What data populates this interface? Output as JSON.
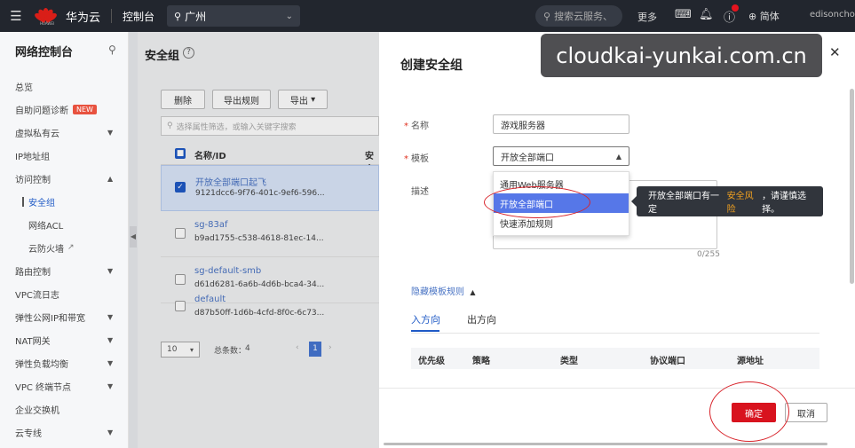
{
  "topbar": {
    "brand_name": "华为云",
    "brand_logo_text": "HUAWEI",
    "console": "控制台",
    "region": "广州",
    "search_placeholder": "搜索云服务、",
    "more": "更多",
    "language": "简体",
    "user": "edisonchoi"
  },
  "sidebar": {
    "title": "网络控制台",
    "items": [
      {
        "label": "总览"
      },
      {
        "label": "自助问题诊断",
        "badge": "NEW"
      },
      {
        "label": "虚拟私有云"
      },
      {
        "label": "IP地址组"
      },
      {
        "label": "访问控制"
      },
      {
        "label": "安全组"
      },
      {
        "label": "网络ACL"
      },
      {
        "label": "云防火墙"
      },
      {
        "label": "路由控制"
      },
      {
        "label": "VPC流日志"
      },
      {
        "label": "弹性公网IP和带宽"
      },
      {
        "label": "NAT网关"
      },
      {
        "label": "弹性负载均衡"
      },
      {
        "label": "VPC 终端节点"
      },
      {
        "label": "企业交换机"
      },
      {
        "label": "云专线"
      }
    ]
  },
  "main": {
    "title": "安全组",
    "buttons": {
      "delete": "删除",
      "export_rules": "导出规则",
      "export": "导出"
    },
    "filter_placeholder": "选择属性筛选，或输入关键字搜索",
    "columns": {
      "name_id": "名称/ID",
      "security": "安全"
    },
    "rows": [
      {
        "name": "开放全部端口起飞",
        "id": "9121dcc6-9f76-401c-9ef6-596..."
      },
      {
        "name": "sg-83af",
        "id": "b9ad1755-c538-4618-81ec-14..."
      },
      {
        "name": "sg-default-smb",
        "id": "d61d6281-6a6b-4d6b-bca4-34..."
      },
      {
        "name": "default",
        "id": "d87b50ff-1d6b-4cfd-8f0c-6c73..."
      }
    ],
    "pager": {
      "size": "10",
      "total_label": "总条数：",
      "total": "4",
      "current": "1"
    }
  },
  "panel": {
    "title": "创建安全组",
    "watermark": "cloudkai-yunkai.com.cn",
    "name_label": "名称",
    "name_value": "游戏服务器",
    "template_label": "模板",
    "template_value": "开放全部端口",
    "desc_label": "描述",
    "counter": "0/255",
    "options": [
      "通用Web服务器",
      "开放全部端口",
      "快速添加规则"
    ],
    "tooltip_before": "开放全部端口有一定",
    "tooltip_warn": "安全风险",
    "tooltip_after": "，请谨慎选择。",
    "hide_rules": "隐藏模板规则",
    "tabs": [
      "入方向",
      "出方向"
    ],
    "rule_columns": [
      "优先级",
      "策略",
      "类型",
      "协议端口",
      "源地址"
    ],
    "ok": "确定",
    "cancel": "取消"
  },
  "colors": {
    "accent": "#1f5ac6",
    "danger": "#d8131e",
    "topbar": "#22262e"
  }
}
